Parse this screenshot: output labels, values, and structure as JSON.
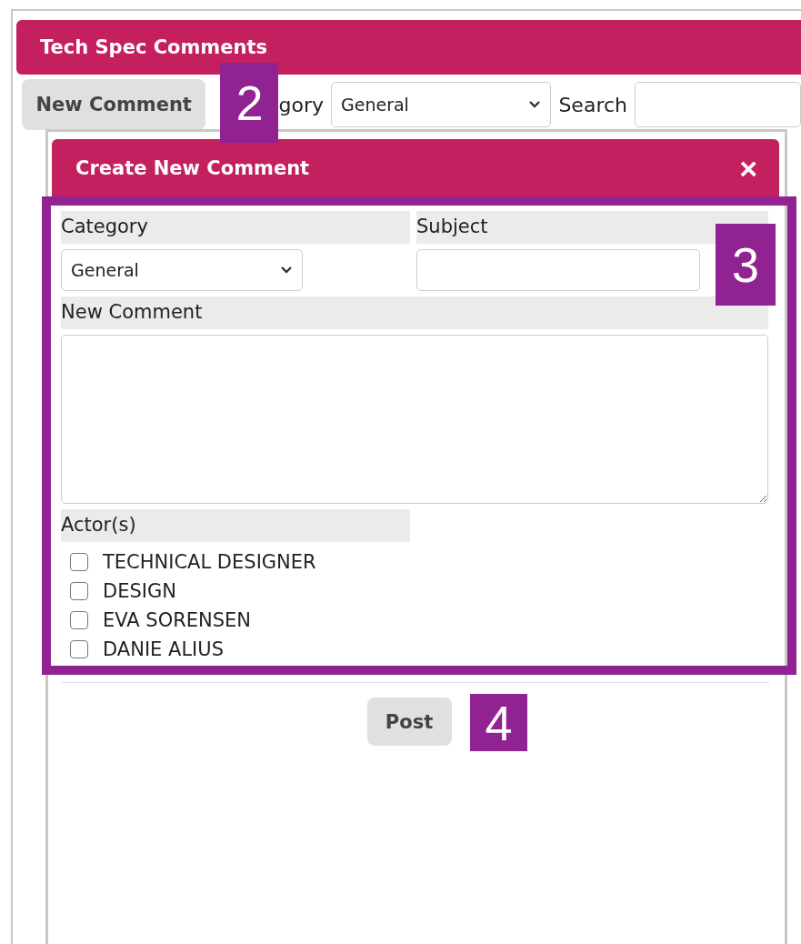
{
  "panel": {
    "title": "Tech Spec Comments"
  },
  "toolbar": {
    "new_button": "New Comment",
    "category_label": "gory",
    "category_value": "General",
    "search_label": "Search"
  },
  "dialog": {
    "title": "Create New Comment",
    "close": "×",
    "category_label": "Category",
    "category_value": "General",
    "subject_label": "Subject",
    "comment_label": "New Comment",
    "actors_label": "Actor(s)",
    "actors": [
      {
        "name": "TECHNICAL DESIGNER",
        "checked": false
      },
      {
        "name": "DESIGN",
        "checked": false
      },
      {
        "name": "EVA SORENSEN",
        "checked": false
      },
      {
        "name": "DANIE ALIUS",
        "checked": false
      }
    ],
    "post_button": "Post"
  },
  "callouts": [
    "2",
    "3",
    "4"
  ]
}
